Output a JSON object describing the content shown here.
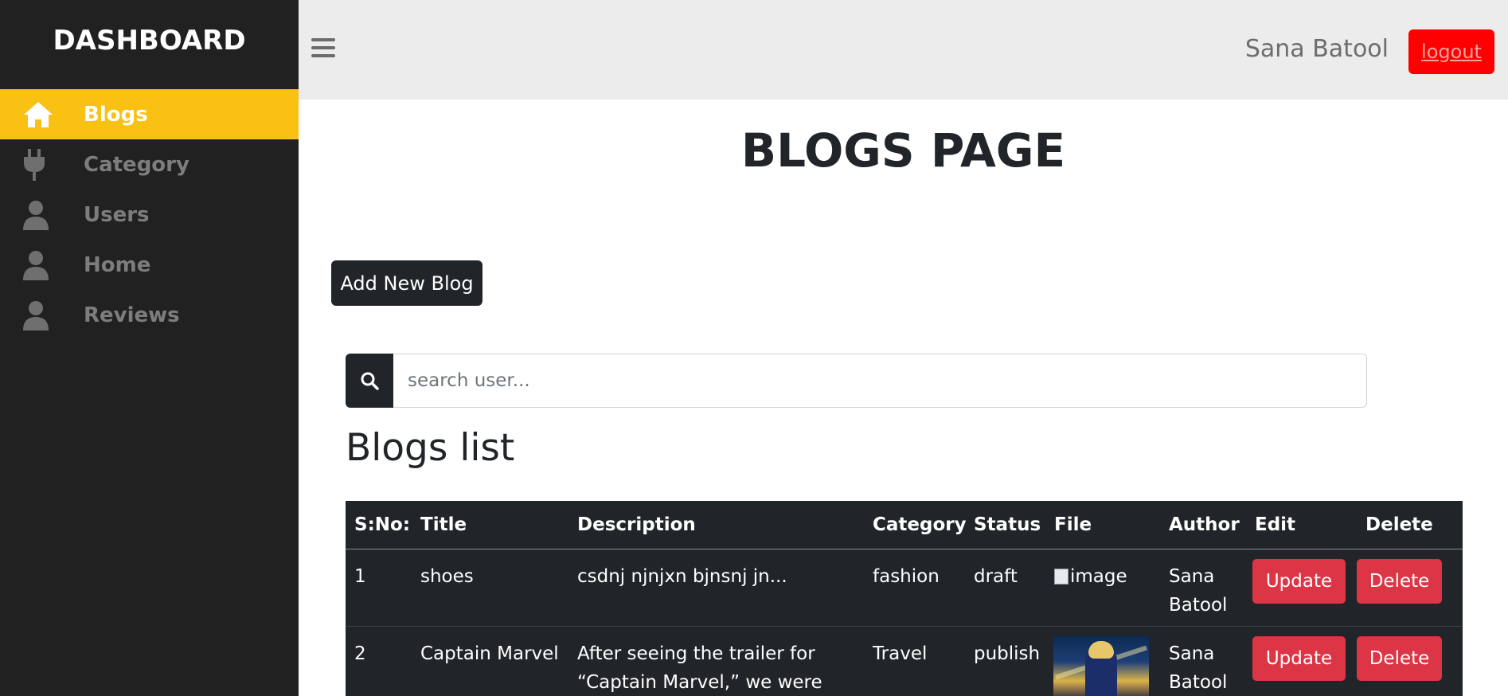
{
  "sidebar": {
    "brand": "DASHBOARD",
    "items": [
      {
        "label": "Blogs",
        "icon": "home-icon",
        "active": true
      },
      {
        "label": "Category",
        "icon": "plug-icon",
        "active": false
      },
      {
        "label": "Users",
        "icon": "user-icon",
        "active": false
      },
      {
        "label": "Home",
        "icon": "user-icon",
        "active": false
      },
      {
        "label": "Reviews",
        "icon": "user-icon",
        "active": false
      }
    ]
  },
  "header": {
    "menu_icon": "hamburger-icon",
    "user_name": "Sana Batool",
    "logout_label": "logout"
  },
  "main": {
    "page_title": "BLOGS PAGE",
    "add_button_label": "Add New Blog",
    "search": {
      "placeholder": "search user...",
      "value": "",
      "icon": "search-icon"
    },
    "list_title": "Blogs list",
    "table": {
      "columns": [
        "S:No:",
        "Title",
        "Description",
        "Category",
        "Status",
        "File",
        "Author",
        "Edit",
        "Delete"
      ],
      "rows": [
        {
          "sno": "1",
          "title": "shoes",
          "description": "csdnj njnjxn bjnsnj jn...",
          "category": "fashion",
          "status": "draft",
          "file_alt": "image",
          "author_line1": "Sana",
          "author_line2": "Batool",
          "edit_label": "Update",
          "delete_label": "Delete"
        },
        {
          "sno": "2",
          "title": "Captain Marvel",
          "description_line1": "After seeing the trailer for",
          "description_line2": "“Captain Marvel,” we were",
          "category": "Travel",
          "status": "publish",
          "author_line1": "Sana",
          "author_line2": "Batool",
          "edit_label": "Update",
          "delete_label": "Delete"
        }
      ]
    }
  },
  "colors": {
    "sidebar_bg": "#212121",
    "sidebar_active": "#f9c113",
    "header_bg": "#ececec",
    "logout_bg": "#ff0000",
    "table_bg": "#212529",
    "danger": "#dc3545"
  }
}
